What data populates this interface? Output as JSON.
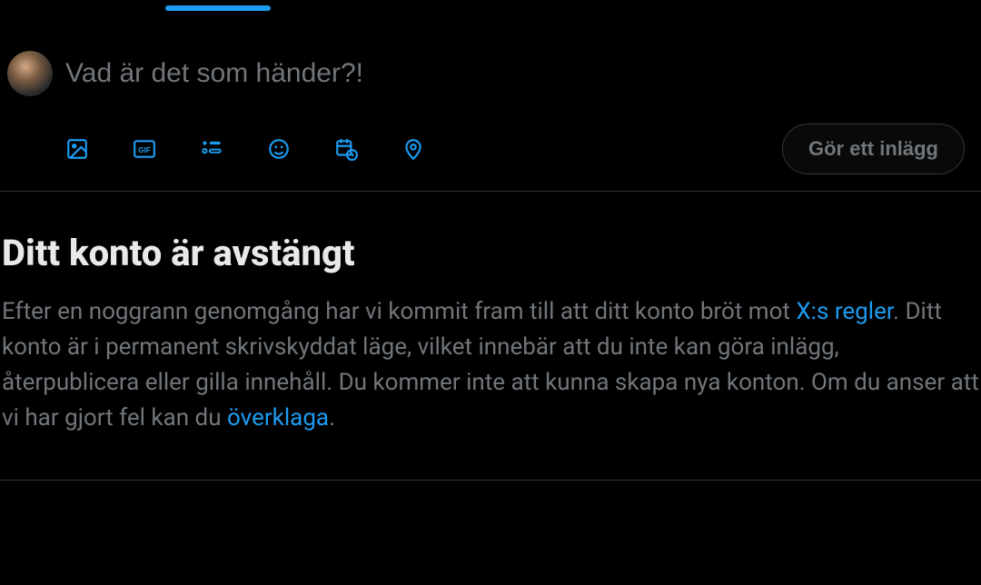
{
  "composer": {
    "placeholder": "Vad är det som händer?!",
    "post_button": "Gör ett inlägg",
    "icons": {
      "image": "image-icon",
      "gif": "gif-icon",
      "poll": "poll-icon",
      "emoji": "emoji-icon",
      "schedule": "schedule-icon",
      "location": "location-icon"
    }
  },
  "notice": {
    "title": "Ditt konto är avstängt",
    "body_part1": "Efter en noggrann genomgång har vi kommit fram till att ditt konto bröt mot ",
    "link1": "X:s regler",
    "body_part2": ". Ditt konto är i permanent skrivskyddat läge, vilket innebär att du inte kan göra inlägg, återpublicera eller gilla innehåll. Du kommer inte att kunna skapa nya konton. Om du anser att vi har gjort fel kan du ",
    "link2": "överklaga",
    "body_part3": "."
  },
  "colors": {
    "accent": "#1d9bf0",
    "text_muted": "#71767b",
    "text_primary": "#e7e9ea"
  }
}
